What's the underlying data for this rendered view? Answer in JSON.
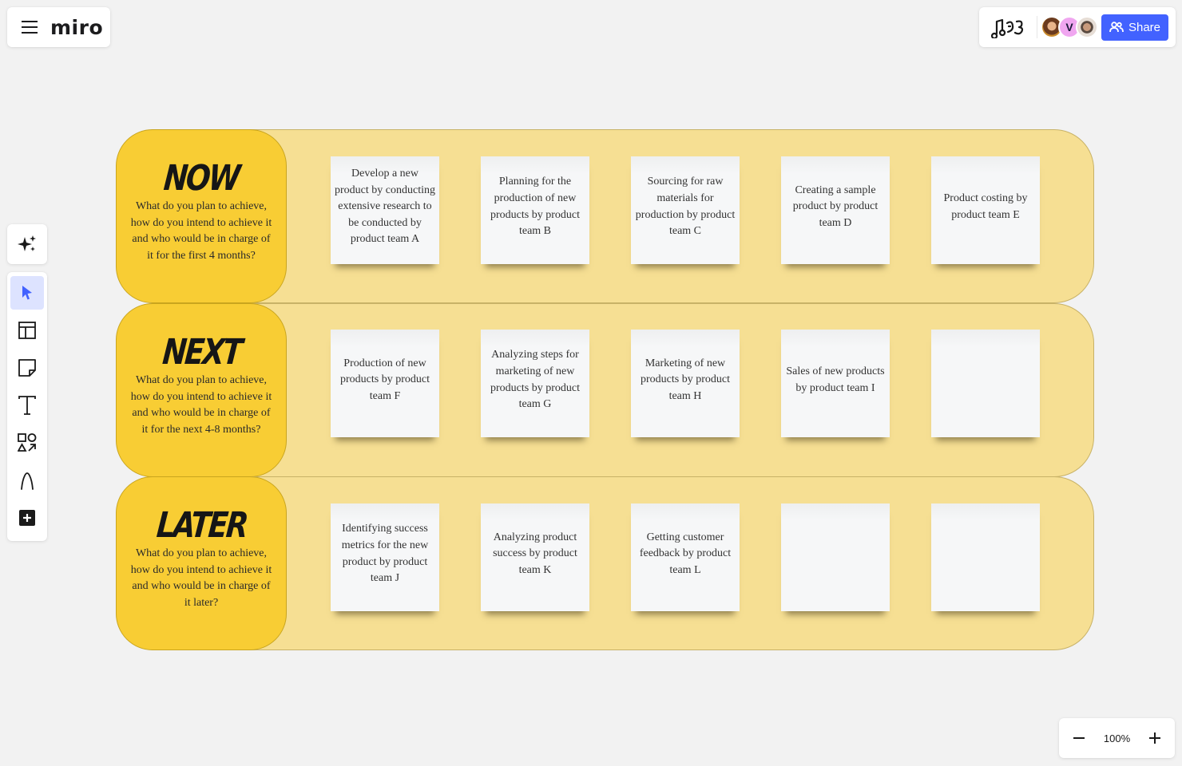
{
  "app": {
    "logo_text": "miro",
    "menu_icon": "hamburger-menu-icon"
  },
  "header": {
    "reaction_icon": "reactions-icon",
    "collaborators": [
      {
        "name": "collaborator-1",
        "type": "photo",
        "color": "#c98a2c"
      },
      {
        "name": "collaborator-2",
        "type": "initial",
        "initial": "V",
        "color": "#f0a6f0"
      },
      {
        "name": "collaborator-3",
        "type": "photo",
        "color": "#d9c7b8"
      }
    ],
    "share_label": "Share",
    "share_color": "#4262ff"
  },
  "toolbar": {
    "ai_icon": "sparkle-icon",
    "tools": [
      {
        "name": "select-tool",
        "icon": "cursor-icon",
        "active": true
      },
      {
        "name": "templates-tool",
        "icon": "template-icon",
        "active": false
      },
      {
        "name": "sticky-note-tool",
        "icon": "sticky-note-icon",
        "active": false
      },
      {
        "name": "text-tool",
        "icon": "text-icon",
        "active": false
      },
      {
        "name": "shapes-tool",
        "icon": "shapes-icon",
        "active": false
      },
      {
        "name": "pen-tool",
        "icon": "pen-icon",
        "active": false
      },
      {
        "name": "more-tools",
        "icon": "plus-icon",
        "active": false
      }
    ]
  },
  "zoom": {
    "level": "100%",
    "zoom_out_icon": "minus-icon",
    "zoom_in_icon": "plus-icon"
  },
  "board": {
    "colors": {
      "row_bg": "#f6df93",
      "label_bg": "#f8cd34",
      "note_bg": "#f6f7f8"
    },
    "rows": [
      {
        "title": "NOW",
        "description": "What do you plan to achieve, how do you intend to achieve it and who would be in charge of it for the first 4 months?",
        "notes": [
          "Develop a new product by conducting extensive research to be conducted by product team A",
          "Planning for the production of new products by product team B",
          "Sourcing for raw materials for production by product team C",
          "Creating a sample product by product team D",
          "Product costing by product team E"
        ]
      },
      {
        "title": "NEXT",
        "description": "What do you plan to achieve, how do you intend to achieve it and who would be in charge of it for the next 4-8 months?",
        "notes": [
          "Production of new products by product team F",
          "Analyzing steps for marketing of new products by product team G",
          "Marketing of new products by product team H",
          "Sales of new products by product team I",
          ""
        ]
      },
      {
        "title": "LATER",
        "description": "What do you plan to achieve, how do you intend to achieve it and who would be in charge of it later?",
        "notes": [
          "Identifying success metrics for the new product by product team  J",
          "Analyzing product success by product team K",
          "Getting customer feedback by product team L",
          "",
          ""
        ]
      }
    ]
  }
}
